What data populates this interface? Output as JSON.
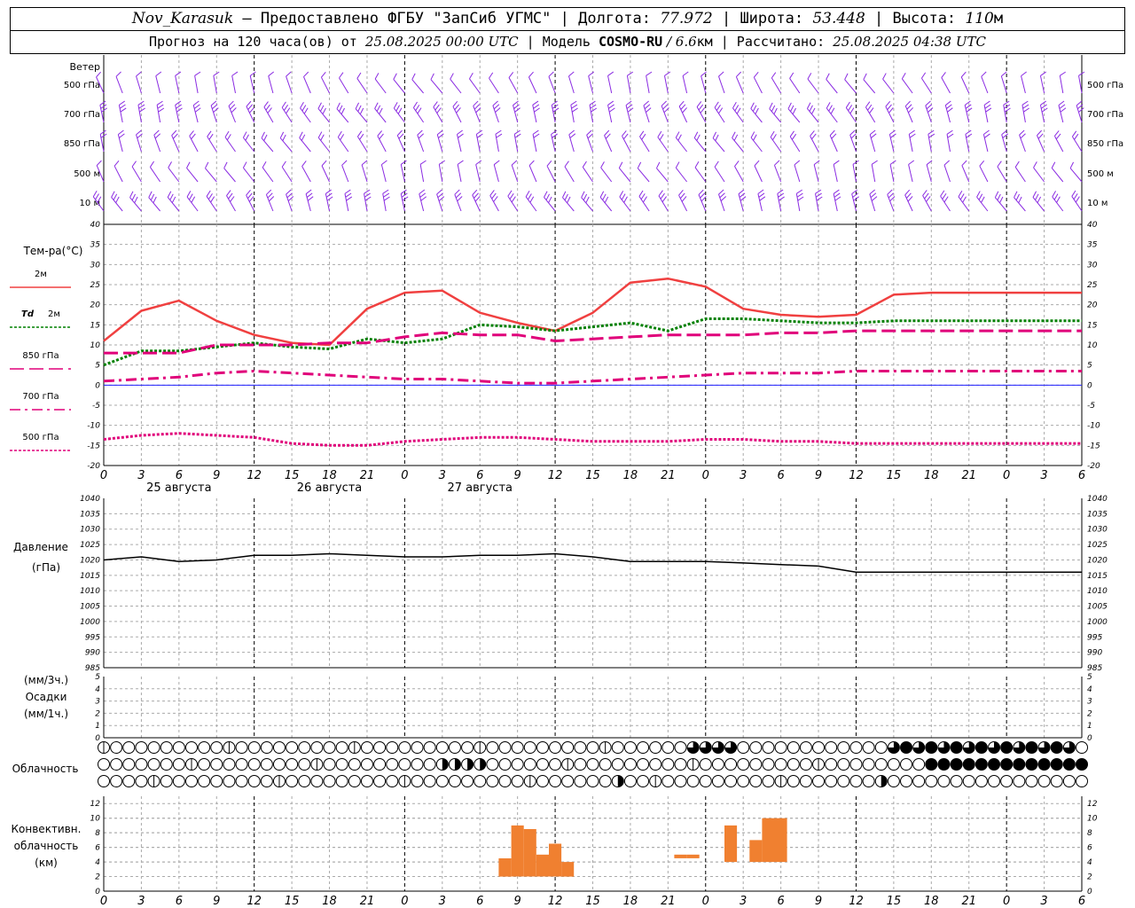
{
  "header": {
    "station": "Nov_Karasuk",
    "dash": " – ",
    "provider": "Предоставлено ФГБУ \"ЗапСиб УГМС\" | ",
    "lon_label": "Долгота: ",
    "lon_value": "77.972",
    "lat_label": " | Широта: ",
    "lat_value": "53.448",
    "alt_label": " | Высота: ",
    "alt_value": "110",
    "alt_unit": "м",
    "forecast_label": "Прогноз на 120 часа(ов) от ",
    "init_time": "25.08.2025 00:00 UTC",
    "model_label": " | Модель ",
    "model_name": "COSMO-RU",
    "model_res_sep": " / ",
    "model_res": "6.6",
    "model_res_unit": "км | Рассчитано: ",
    "calc_time": "25.08.2025 04:38 UTC"
  },
  "colors": {
    "t2m": "#f04040",
    "td2m": "#008000",
    "t850": "#e0007a",
    "t700": "#e0007a",
    "t500": "#e0007a",
    "zero_line": "#2020ff",
    "pressure": "#000000",
    "wind": "#8a2be2",
    "convective": "#f08030",
    "grid": "#999999"
  },
  "wind_panel": {
    "title": "Ветер",
    "levels": [
      "500 гПа",
      "700 гПа",
      "850 гПа",
      "500 м",
      "10 м"
    ],
    "icon": "wind-barb-icon"
  },
  "temp_panel": {
    "title": "Тем-ра(°С)",
    "legend": [
      {
        "name": "2м",
        "prefix": "",
        "key": "t2m",
        "style": "solid"
      },
      {
        "name": "2м",
        "prefix": "Td",
        "key": "td2m",
        "style": "dotted"
      },
      {
        "name": "850 гПа",
        "prefix": "",
        "key": "t850",
        "style": "dashed"
      },
      {
        "name": "700 гПа",
        "prefix": "",
        "key": "t700",
        "style": "dashdot"
      },
      {
        "name": "500 гПа",
        "prefix": "",
        "key": "t500",
        "style": "dotted"
      }
    ],
    "yticks": [
      "40",
      "35",
      "30",
      "25",
      "20",
      "15",
      "10",
      "5",
      "0",
      "-5",
      "-10",
      "-15",
      "-20"
    ]
  },
  "hour_ticks": [
    "0",
    "3",
    "6",
    "9",
    "12",
    "15",
    "18",
    "21",
    "0",
    "3",
    "6",
    "9",
    "12",
    "15",
    "18",
    "21",
    "0",
    "3",
    "6",
    "9",
    "12",
    "15",
    "18",
    "21",
    "0",
    "3",
    "6"
  ],
  "dates": [
    "25 августа",
    "26 августа",
    "27 августа"
  ],
  "pressure_panel": {
    "title": "Давление",
    "unit": "(гПа)",
    "yticks": [
      "1040",
      "1035",
      "1030",
      "1025",
      "1020",
      "1015",
      "1010",
      "1005",
      "1000",
      "995",
      "990",
      "985"
    ]
  },
  "precip_panel": {
    "unit3": "(мм/3ч.)",
    "title": "Осадки",
    "unit1": "(мм/1ч.)",
    "yticks": [
      "5",
      "4",
      "3",
      "2",
      "1",
      "0"
    ]
  },
  "cloud_panel": {
    "title": "Облачность",
    "icon": "cloud-cover-circle-icon"
  },
  "conv_panel": {
    "title1": "Конвективн.",
    "title2": "облачность",
    "unit": "(км)",
    "yticks": [
      "12",
      "10",
      "8",
      "6",
      "4",
      "2",
      "0"
    ]
  },
  "chart_data": [
    {
      "type": "line",
      "title": "Тем-ра(°С)",
      "x_unit": "hours from 25.08.2025 00:00 UTC",
      "ylim": [
        -20,
        40
      ],
      "grid": true,
      "x": [
        0,
        6,
        12,
        18,
        24,
        30,
        36,
        42,
        48,
        54,
        60,
        66,
        72,
        78,
        84,
        90,
        96,
        102,
        108,
        114,
        120,
        126,
        132,
        138,
        144,
        150,
        156
      ],
      "series": [
        {
          "name": "2м",
          "values": [
            11,
            18.5,
            21,
            16,
            12.5,
            10.5,
            10,
            19,
            23,
            23.5,
            18,
            15.5,
            13.5,
            18,
            25.5,
            26.5,
            24.5,
            19,
            17.5,
            17,
            17.5,
            22.5,
            23,
            23,
            23,
            23,
            23
          ]
        },
        {
          "name": "Td 2м",
          "values": [
            5,
            8.5,
            8.5,
            9.5,
            10.5,
            9.5,
            9,
            11.5,
            10.5,
            11.5,
            15,
            14.5,
            13.5,
            14.5,
            15.5,
            13.5,
            16.5,
            16.5,
            16,
            15.5,
            15.5,
            16,
            16,
            16,
            16,
            16,
            16
          ]
        },
        {
          "name": "850 гПа",
          "values": [
            8,
            8,
            8,
            10,
            10,
            10,
            10.5,
            10.5,
            12,
            13,
            12.5,
            12.5,
            11,
            11.5,
            12,
            12.5,
            12.5,
            12.5,
            13,
            13,
            13.5,
            13.5,
            13.5,
            13.5,
            13.5,
            13.5,
            13.5
          ]
        },
        {
          "name": "700 гПа",
          "values": [
            1,
            1.5,
            2,
            3,
            3.5,
            3,
            2.5,
            2,
            1.5,
            1.5,
            1,
            0.5,
            0.5,
            1,
            1.5,
            2,
            2.5,
            3,
            3,
            3,
            3.5,
            3.5,
            3.5,
            3.5,
            3.5,
            3.5,
            3.5
          ]
        },
        {
          "name": "500 гПа",
          "values": [
            -13.5,
            -12.5,
            -12,
            -12.5,
            -13,
            -14.5,
            -15,
            -15,
            -14,
            -13.5,
            -13,
            -13,
            -13.5,
            -14,
            -14,
            -14,
            -13.5,
            -13.5,
            -14,
            -14,
            -14.5,
            -14.5,
            -14.5,
            -14.5,
            -14.5,
            -14.5,
            -14.5
          ]
        }
      ]
    },
    {
      "type": "line",
      "title": "Давление",
      "x_unit": "hours from 25.08.2025 00:00 UTC",
      "ylim": [
        985,
        1040
      ],
      "grid": true,
      "x": [
        0,
        6,
        12,
        18,
        24,
        30,
        36,
        42,
        48,
        54,
        60,
        66,
        72,
        78,
        84,
        90,
        96,
        102,
        108,
        114,
        120,
        126,
        132,
        138,
        144,
        150,
        156
      ],
      "series": [
        {
          "name": "Давление",
          "values": [
            1020,
            1021,
            1019.5,
            1020,
            1021.5,
            1021.5,
            1022,
            1021.5,
            1021,
            1021,
            1021.5,
            1021.5,
            1022,
            1021,
            1019.5,
            1019.5,
            1019.5,
            1019,
            1018.5,
            1018,
            1016,
            1016,
            1016,
            1016,
            1016,
            1016,
            1016
          ]
        }
      ]
    },
    {
      "type": "bar",
      "title": "Конвективн. облачность",
      "x_unit": "hours from 25.08.2025 00:00 UTC",
      "ylim": [
        0,
        13
      ],
      "grid": true,
      "series": [
        {
          "name": "Конвективн. облачность",
          "bars": [
            {
              "x": 64,
              "bottom": 2,
              "top": 4.5
            },
            {
              "x": 66,
              "bottom": 2,
              "top": 9
            },
            {
              "x": 68,
              "bottom": 2,
              "top": 8.5
            },
            {
              "x": 70,
              "bottom": 2,
              "top": 5
            },
            {
              "x": 72,
              "bottom": 2,
              "top": 6.5
            },
            {
              "x": 74,
              "bottom": 2,
              "top": 4
            },
            {
              "x": 92,
              "bottom": 4.5,
              "top": 5
            },
            {
              "x": 94,
              "bottom": 4.5,
              "top": 5
            },
            {
              "x": 100,
              "bottom": 4,
              "top": 9
            },
            {
              "x": 104,
              "bottom": 4,
              "top": 7
            },
            {
              "x": 106,
              "bottom": 4,
              "top": 10
            },
            {
              "x": 108,
              "bottom": 4,
              "top": 10
            }
          ]
        }
      ]
    }
  ]
}
